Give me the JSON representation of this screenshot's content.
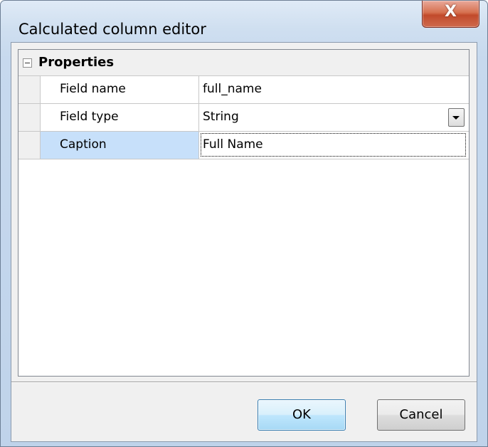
{
  "window": {
    "title": "Calculated column editor",
    "close_glyph": "X"
  },
  "grid": {
    "category": {
      "label": "Properties",
      "expanded": true
    },
    "rows": [
      {
        "name": "Field name",
        "value": "full_name"
      },
      {
        "name": "Field type",
        "value": "String",
        "editor": "dropdown"
      },
      {
        "name": "Caption",
        "value": "Full Name",
        "selected": true
      }
    ]
  },
  "buttons": {
    "ok_label": "OK",
    "cancel_label": "Cancel"
  },
  "colors": {
    "selection": "#c7e0fa",
    "default_button_border": "#3c7fb1",
    "close_button": "#c14a2b"
  }
}
